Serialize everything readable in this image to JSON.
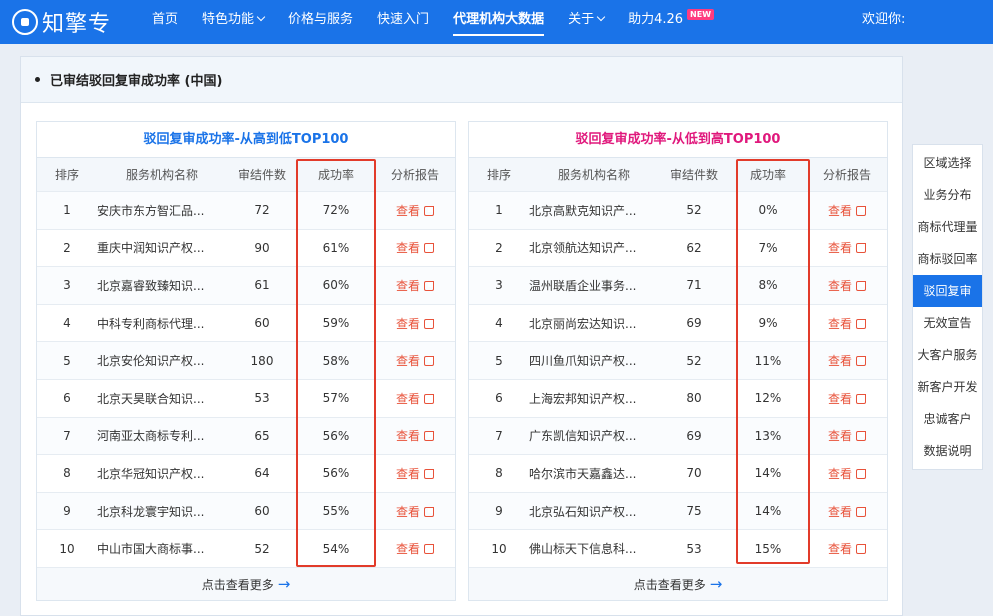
{
  "nav": {
    "logo": "知擎专",
    "items": [
      {
        "label": "首页",
        "chevron": false,
        "active": false,
        "badge": ""
      },
      {
        "label": "特色功能",
        "chevron": true,
        "active": false,
        "badge": ""
      },
      {
        "label": "价格与服务",
        "chevron": false,
        "active": false,
        "badge": ""
      },
      {
        "label": "快速入门",
        "chevron": false,
        "active": false,
        "badge": ""
      },
      {
        "label": "代理机构大数据",
        "chevron": false,
        "active": true,
        "badge": ""
      },
      {
        "label": "关于",
        "chevron": true,
        "active": false,
        "badge": ""
      },
      {
        "label": "助力4.26",
        "chevron": false,
        "active": false,
        "badge": "NEW"
      }
    ],
    "welcome": "欢迎你:"
  },
  "panel": {
    "title": "已审结驳回复审成功率 (中国)"
  },
  "columns": {
    "rank": "排序",
    "name": "服务机构名称",
    "count": "审结件数",
    "rate": "成功率",
    "report": "分析报告"
  },
  "view_label": "查看",
  "more_label": "点击查看更多",
  "left_table": {
    "title": "驳回复审成功率-从高到低TOP100",
    "rows": [
      {
        "rank": "1",
        "name": "安庆市东方智汇品...",
        "count": "72",
        "rate": "72%"
      },
      {
        "rank": "2",
        "name": "重庆中润知识产权...",
        "count": "90",
        "rate": "61%"
      },
      {
        "rank": "3",
        "name": "北京嘉睿致臻知识...",
        "count": "61",
        "rate": "60%"
      },
      {
        "rank": "4",
        "name": "中科专利商标代理...",
        "count": "60",
        "rate": "59%"
      },
      {
        "rank": "5",
        "name": "北京安伦知识产权...",
        "count": "180",
        "rate": "58%"
      },
      {
        "rank": "6",
        "name": "北京天昊联合知识...",
        "count": "53",
        "rate": "57%"
      },
      {
        "rank": "7",
        "name": "河南亚太商标专利...",
        "count": "65",
        "rate": "56%"
      },
      {
        "rank": "8",
        "name": "北京华冠知识产权...",
        "count": "64",
        "rate": "56%"
      },
      {
        "rank": "9",
        "name": "北京科龙寰宇知识...",
        "count": "60",
        "rate": "55%"
      },
      {
        "rank": "10",
        "name": "中山市国大商标事...",
        "count": "52",
        "rate": "54%"
      }
    ]
  },
  "right_table": {
    "title": "驳回复审成功率-从低到高TOP100",
    "rows": [
      {
        "rank": "1",
        "name": "北京高默克知识产...",
        "count": "52",
        "rate": "0%"
      },
      {
        "rank": "2",
        "name": "北京领航达知识产...",
        "count": "62",
        "rate": "7%"
      },
      {
        "rank": "3",
        "name": "温州联盾企业事务...",
        "count": "71",
        "rate": "8%"
      },
      {
        "rank": "4",
        "name": "北京丽尚宏达知识...",
        "count": "69",
        "rate": "9%"
      },
      {
        "rank": "5",
        "name": "四川鱼爪知识产权...",
        "count": "52",
        "rate": "11%"
      },
      {
        "rank": "6",
        "name": "上海宏邦知识产权...",
        "count": "80",
        "rate": "12%"
      },
      {
        "rank": "7",
        "name": "广东凯信知识产权...",
        "count": "69",
        "rate": "13%"
      },
      {
        "rank": "8",
        "name": "哈尔滨市天嘉鑫达...",
        "count": "70",
        "rate": "14%"
      },
      {
        "rank": "9",
        "name": "北京弘石知识产权...",
        "count": "75",
        "rate": "14%"
      },
      {
        "rank": "10",
        "name": "佛山标天下信息科...",
        "count": "53",
        "rate": "15%"
      }
    ]
  },
  "side_menu": {
    "items": [
      {
        "label": "区域选择",
        "active": false
      },
      {
        "label": "业务分布",
        "active": false
      },
      {
        "label": "商标代理量",
        "active": false
      },
      {
        "label": "商标驳回率",
        "active": false
      },
      {
        "label": "驳回复审",
        "active": true
      },
      {
        "label": "无效宣告",
        "active": false
      },
      {
        "label": "大客户服务",
        "active": false
      },
      {
        "label": "新客户开发",
        "active": false
      },
      {
        "label": "忠诚客户",
        "active": false
      },
      {
        "label": "数据说明",
        "active": false
      }
    ]
  },
  "colors": {
    "brand": "#1a73e8",
    "high_title": "#1a73e8",
    "low_title": "#e0187c",
    "link": "#e8523a",
    "highlight_box": "#e23b2a"
  }
}
